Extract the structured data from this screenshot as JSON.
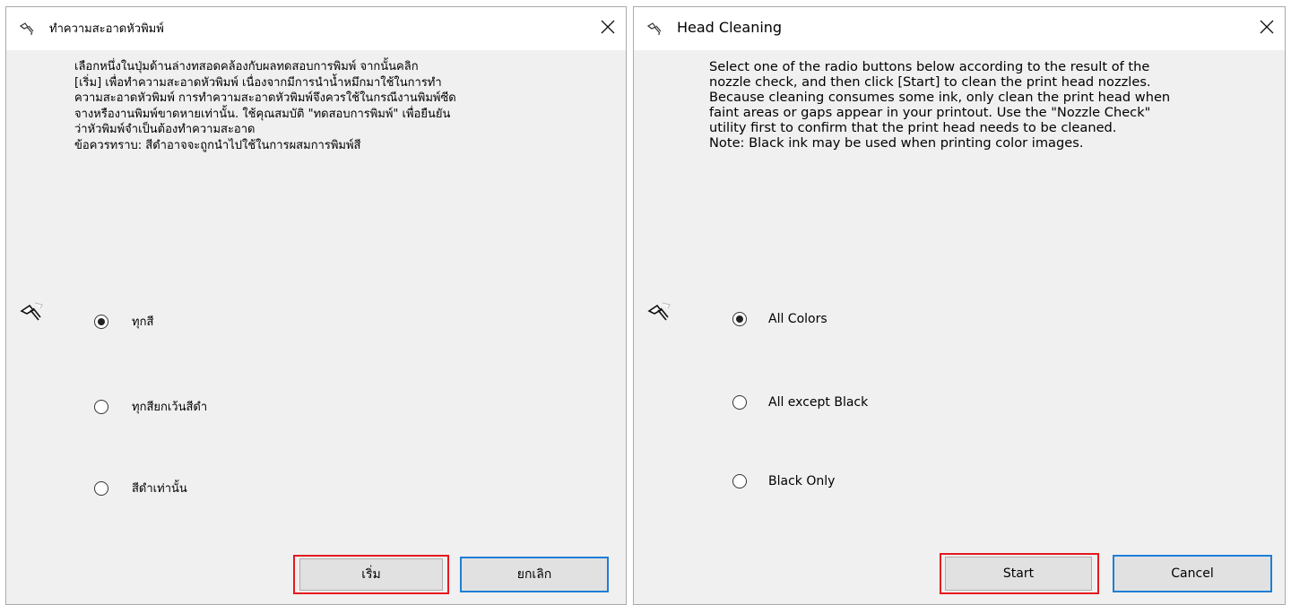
{
  "thai_dialog": {
    "title": "ทำความสะอาดหัวพิมพ์",
    "description": "เลือกหนึ่งในปุ่มด้านล่างทสอดคล้องกับผลทดสอบการพิมพ์ จากนั้นคลิก\n[เริ่ม] เพื่อทำความสะอาดหัวพิมพ์ เนื่องจากมีการนำน้ำหมึกมาใช้ในการทำ\nความสะอาดหัวพิมพ์ การทำความสะอาดหัวพิมพ์จึงควรใช้ในกรณีงานพิมพ์ซีด\nจางหรืองานพิมพ์ขาดหายเท่านั้น. ใช้คุณสมบัติ \"ทดสอบการพิมพ์\" เพื่อยืนยัน\nว่าหัวพิมพ์จำเป็นต้องทำความสะอาด\nข้อควรทราบ: สีดำอาจจะถูกนำไปใช้ในการผสมการพิมพ์สี",
    "options": [
      "ทุกสี",
      "ทุกสียกเว้นสีดำ",
      "สีดำเท่านั้น"
    ],
    "start_label": "เริ่ม",
    "cancel_label": "ยกเลิก"
  },
  "english_dialog": {
    "title": "Head Cleaning",
    "description": "Select one of the radio buttons below according to the result of the\nnozzle check, and then click [Start] to clean the print head nozzles.\nBecause cleaning consumes some ink, only clean the print head when\nfaint areas or gaps appear in your printout. Use the \"Nozzle Check\"\nutility first to confirm that the print head needs to be cleaned.\nNote: Black ink may be used when printing color images.",
    "options": [
      "All Colors",
      "All except Black",
      "Black Only"
    ],
    "start_label": "Start",
    "cancel_label": "Cancel"
  },
  "selected_option_index": 0,
  "icons": {
    "title": "printer-head-icon",
    "close": "close-icon",
    "illustration": "nozzle-icon"
  },
  "colors": {
    "highlight_red": "#e5191f",
    "focus_blue": "#1e7fd6",
    "dialog_bg": "#f0f0f0",
    "button_bg": "#e1e1e1"
  }
}
